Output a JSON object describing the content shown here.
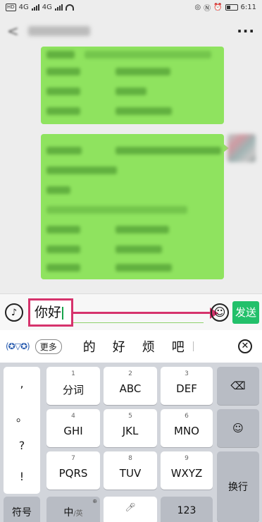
{
  "status": {
    "time": "6:11",
    "signal1": "4G",
    "signal2": "4G"
  },
  "titlebar": {
    "back_glyph": "<",
    "more_glyph": "···"
  },
  "input": {
    "text": "你好",
    "send_label": "发送"
  },
  "candidates": {
    "more_label": "更多",
    "words": [
      "的",
      "好",
      "烦",
      "吧"
    ]
  },
  "keyboard": {
    "punctuation": [
      ",",
      "。",
      "?",
      "!"
    ],
    "keys": [
      {
        "num": "1",
        "label": "分词"
      },
      {
        "num": "2",
        "label": "ABC"
      },
      {
        "num": "3",
        "label": "DEF"
      },
      {
        "num": "4",
        "label": "GHI"
      },
      {
        "num": "5",
        "label": "JKL"
      },
      {
        "num": "6",
        "label": "MNO"
      },
      {
        "num": "7",
        "label": "PQRS"
      },
      {
        "num": "8",
        "label": "TUV"
      },
      {
        "num": "9",
        "label": "WXYZ"
      }
    ],
    "symbol_label": "符号",
    "chinese_label": "中",
    "english_sub": "/英",
    "numbers_label": "123",
    "enter_label": "换行"
  },
  "icons": {
    "back": "chevron-left-icon",
    "more": "more-dots-icon",
    "voice": "voice-icon",
    "emoji": "emoji-icon",
    "close": "close-circle-icon",
    "backspace": "backspace-icon"
  },
  "colors": {
    "bubble": "#8fe35f",
    "send": "#22c06a",
    "highlight": "#d6336c"
  }
}
